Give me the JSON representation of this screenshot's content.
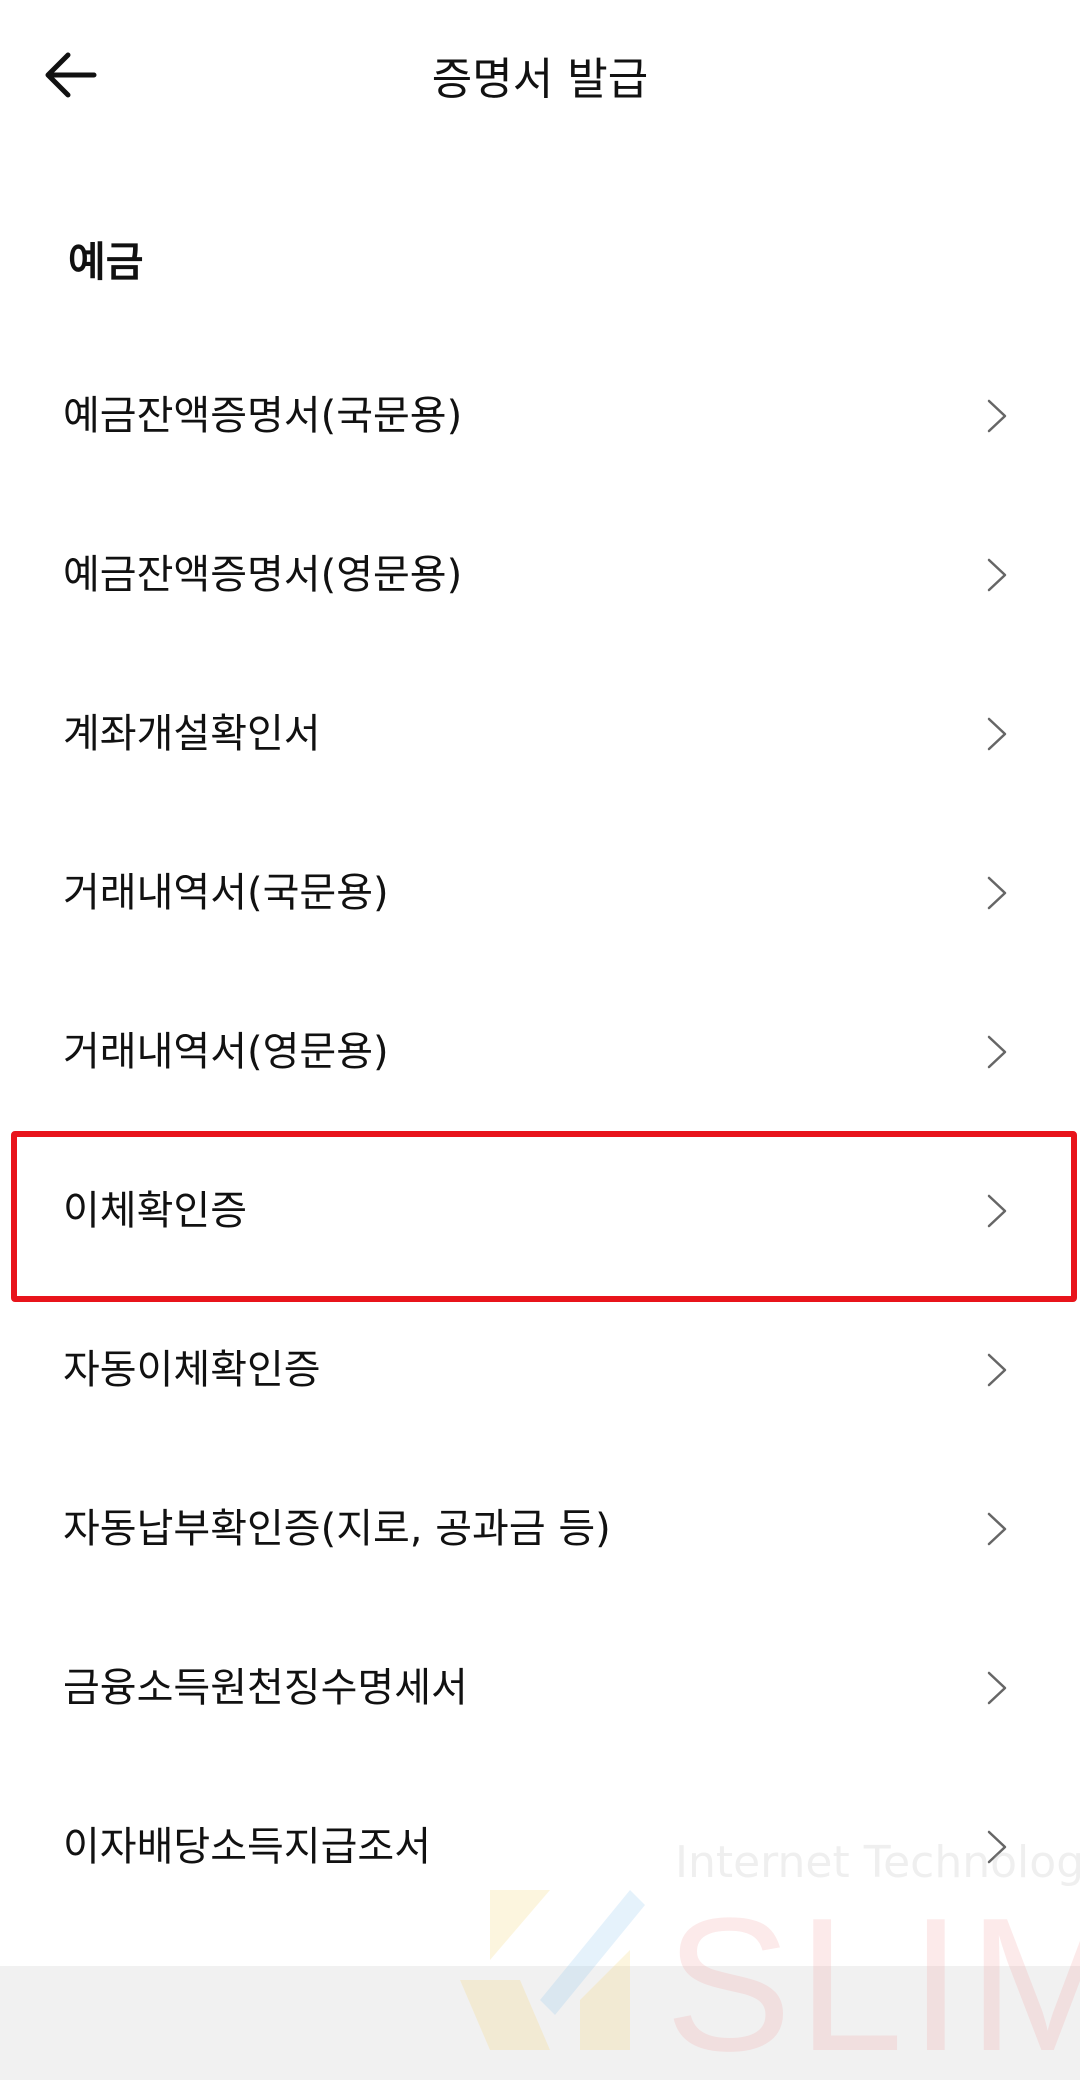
{
  "header": {
    "title": "증명서 발급",
    "back_icon": "arrow-left-icon"
  },
  "section": {
    "label": "예금"
  },
  "menu": {
    "items": [
      {
        "label": "예금잔액증명서(국문용)"
      },
      {
        "label": "예금잔액증명서(영문용)"
      },
      {
        "label": "계좌개설확인서"
      },
      {
        "label": "거래내역서(국문용)"
      },
      {
        "label": "거래내역서(영문용)"
      },
      {
        "label": "이체확인증",
        "highlighted": true
      },
      {
        "label": "자동이체확인증"
      },
      {
        "label": "자동납부확인증(지로, 공과금 등)"
      },
      {
        "label": "금융소득원천징수명세서"
      },
      {
        "label": "이자배당소득지급조서"
      }
    ],
    "chevron_icon": "chevron-right-icon"
  },
  "highlight": {
    "color": "#e8141b"
  },
  "watermark": {
    "caption": "Internet Technology",
    "word": "SLIM"
  }
}
